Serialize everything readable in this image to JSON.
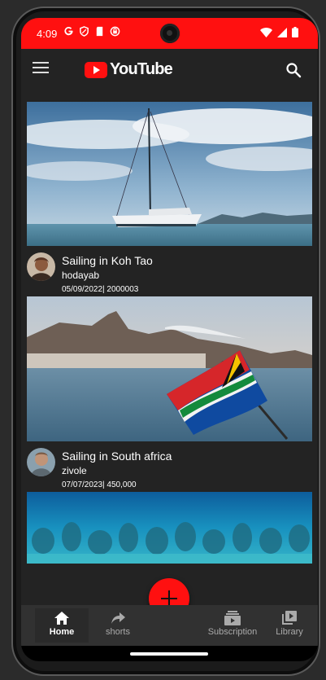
{
  "status_bar": {
    "time": "4:09",
    "left_icons": [
      "google-icon",
      "shield-icon",
      "sd-card-icon",
      "lock-icon"
    ],
    "right_icons": [
      "wifi-icon",
      "signal-icon",
      "battery-icon"
    ],
    "color": "#ff1010"
  },
  "app_bar": {
    "logo_text": "YouTube",
    "brand_color": "#ff1010"
  },
  "videos": [
    {
      "title": "Sailing in Koh Tao",
      "channel": "hodayab",
      "stats": "05/09/2022| 2000003"
    },
    {
      "title": "Sailing in South africa",
      "channel": "zivole",
      "stats": "07/07/2023| 450,000"
    },
    {
      "title": "",
      "channel": "",
      "stats": ""
    }
  ],
  "bottom_nav": {
    "items": [
      {
        "label": "Home",
        "icon": "home-icon",
        "active": true
      },
      {
        "label": "shorts",
        "icon": "share-arrow-icon",
        "active": false
      },
      {
        "label": "Subscription",
        "icon": "subscriptions-icon",
        "active": false
      },
      {
        "label": "Library",
        "icon": "library-icon",
        "active": false
      }
    ],
    "fab_icon": "plus-icon"
  }
}
